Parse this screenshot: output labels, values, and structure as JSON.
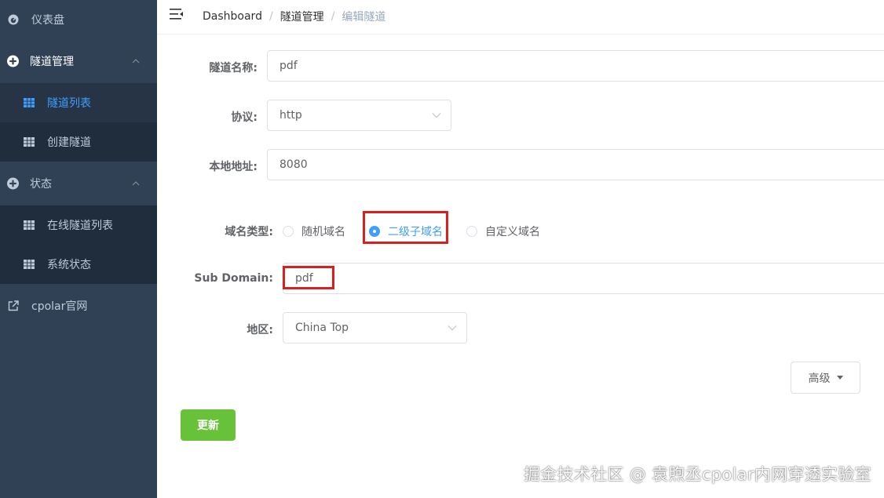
{
  "sidebar": {
    "dashboard": "仪表盘",
    "tunnel_mgmt": "隧道管理",
    "tunnel_list": "隧道列表",
    "create_tunnel": "创建隧道",
    "status": "状态",
    "online_tunnels": "在线隧道列表",
    "system_status": "系统状态",
    "cpolar_site": "cpolar官网"
  },
  "breadcrumb": {
    "home": "Dashboard",
    "section": "隧道管理",
    "current": "编辑隧道",
    "separator": "/"
  },
  "form": {
    "name_label": "隧道名称:",
    "name_value": "pdf",
    "protocol_label": "协议:",
    "protocol_value": "http",
    "local_addr_label": "本地地址:",
    "local_addr_value": "8080",
    "domain_type_label": "域名类型:",
    "domain_type_options": [
      "随机域名",
      "二级子域名",
      "自定义域名"
    ],
    "domain_type_selected": "二级子域名",
    "subdomain_label": "Sub Domain:",
    "subdomain_value": "pdf",
    "region_label": "地区:",
    "region_value": "China Top"
  },
  "buttons": {
    "advanced": "高级",
    "update": "更新"
  },
  "watermark": "掘金技术社区 @ 袁煦丞cpolar内网穿透实验室",
  "colors": {
    "sidebar_bg": "#304156",
    "submenu_bg": "#1f2d3d",
    "active": "#409eff",
    "update_button": "#67c23a",
    "highlight_box": "#d9201f"
  },
  "icons": {
    "dashboard": "dashboard-icon",
    "tunnel_mgmt": "plus-circle-icon",
    "tunnel_list": "table-grid-icon",
    "create_tunnel": "table-grid-icon",
    "status": "plus-circle-icon",
    "online_tunnels": "table-grid-icon",
    "system_status": "table-grid-icon",
    "cpolar_site": "external-link-icon",
    "header": "hamburger-menu-icon"
  }
}
